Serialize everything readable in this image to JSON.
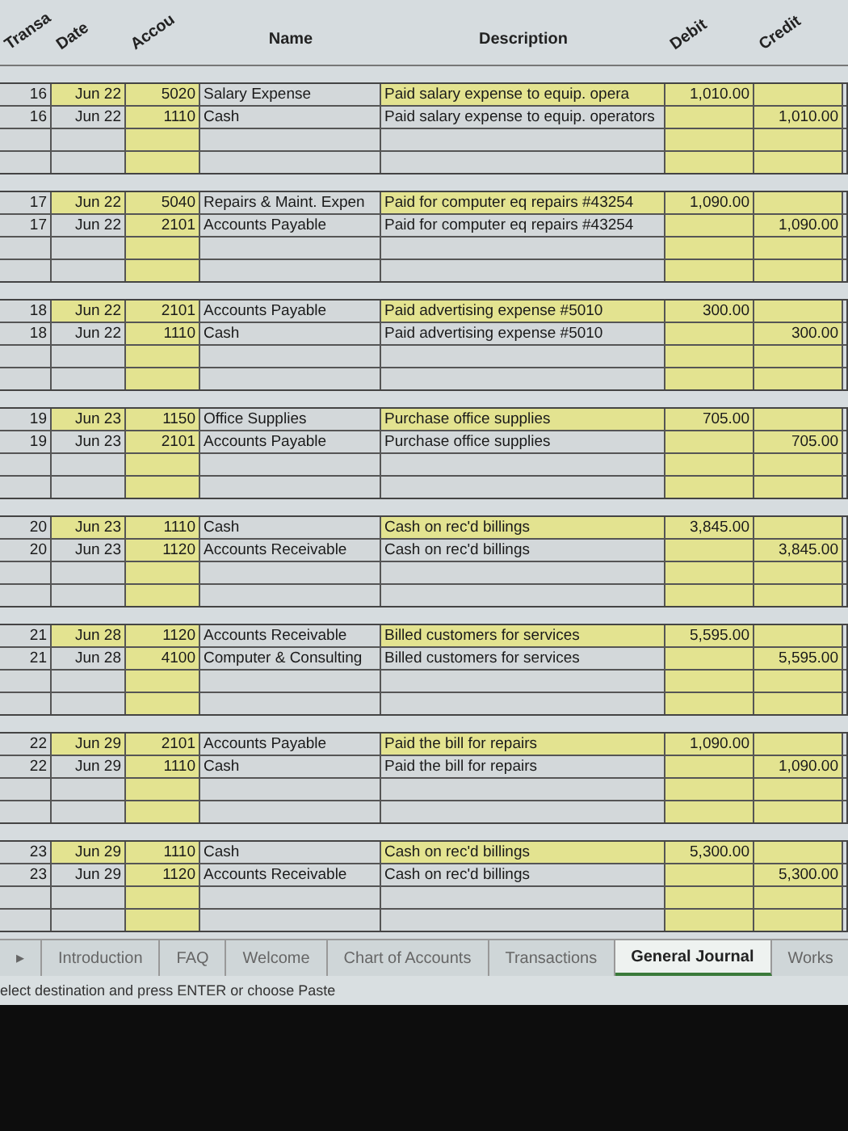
{
  "headers": [
    "Transa",
    "Date",
    "Accou",
    "Name",
    "Description",
    "Debit",
    "Credit"
  ],
  "entries": [
    {
      "lines": [
        {
          "trans": "16",
          "date": "Jun 22",
          "account": "5020",
          "name": "Salary Expense",
          "description": "Paid salary expense to equip. opera",
          "debit": "1,010.00"
        },
        {
          "trans": "16",
          "date": "Jun 22",
          "account": "1110",
          "name": "Cash",
          "description": "Paid salary expense to equip. operators",
          "credit": "1,010.00"
        }
      ]
    },
    {
      "lines": [
        {
          "trans": "17",
          "date": "Jun 22",
          "account": "5040",
          "name": "Repairs & Maint. Expen",
          "description": "Paid for computer eq repairs #43254",
          "debit": "1,090.00"
        },
        {
          "trans": "17",
          "date": "Jun 22",
          "account": "2101",
          "name": "Accounts Payable",
          "description": "Paid for computer eq repairs #43254",
          "credit": "1,090.00"
        }
      ]
    },
    {
      "lines": [
        {
          "trans": "18",
          "date": "Jun 22",
          "account": "2101",
          "name": "Accounts Payable",
          "description": "Paid advertising expense #5010",
          "debit": "300.00"
        },
        {
          "trans": "18",
          "date": "Jun 22",
          "account": "1110",
          "name": "Cash",
          "description": "Paid advertising expense #5010",
          "credit": "300.00"
        }
      ]
    },
    {
      "lines": [
        {
          "trans": "19",
          "date": "Jun 23",
          "account": "1150",
          "name": "Office Supplies",
          "description": "Purchase office supplies",
          "debit": "705.00"
        },
        {
          "trans": "19",
          "date": "Jun 23",
          "account": "2101",
          "name": "Accounts Payable",
          "description": "Purchase office supplies",
          "credit": "705.00"
        }
      ]
    },
    {
      "lines": [
        {
          "trans": "20",
          "date": "Jun 23",
          "account": "1110",
          "name": "Cash",
          "description": "Cash on rec'd billings",
          "debit": "3,845.00"
        },
        {
          "trans": "20",
          "date": "Jun 23",
          "account": "1120",
          "name": "Accounts Receivable",
          "description": "Cash on rec'd billings",
          "credit": "3,845.00"
        }
      ]
    },
    {
      "lines": [
        {
          "trans": "21",
          "date": "Jun 28",
          "account": "1120",
          "name": "Accounts Receivable",
          "description": "Billed customers for services",
          "debit": "5,595.00"
        },
        {
          "trans": "21",
          "date": "Jun 28",
          "account": "4100",
          "name": "Computer & Consulting",
          "description": "Billed customers for services",
          "credit": "5,595.00"
        }
      ]
    },
    {
      "lines": [
        {
          "trans": "22",
          "date": "Jun 29",
          "account": "2101",
          "name": "Accounts Payable",
          "description": "Paid the bill for repairs",
          "debit": "1,090.00"
        },
        {
          "trans": "22",
          "date": "Jun 29",
          "account": "1110",
          "name": "Cash",
          "description": "Paid the bill for repairs",
          "credit": "1,090.00"
        }
      ]
    },
    {
      "lines": [
        {
          "trans": "23",
          "date": "Jun 29",
          "account": "1110",
          "name": "Cash",
          "description": "Cash on rec'd billings",
          "debit": "5,300.00"
        },
        {
          "trans": "23",
          "date": "Jun 29",
          "account": "1120",
          "name": "Accounts Receivable",
          "description": "Cash on rec'd billings",
          "credit": "5,300.00"
        }
      ]
    }
  ],
  "sheet_tabs": [
    {
      "label": "▸",
      "selected": false
    },
    {
      "label": "Introduction",
      "selected": false
    },
    {
      "label": "FAQ",
      "selected": false
    },
    {
      "label": "Welcome",
      "selected": false
    },
    {
      "label": "Chart of Accounts",
      "selected": false
    },
    {
      "label": "Transactions",
      "selected": false
    },
    {
      "label": "General Journal",
      "selected": true
    },
    {
      "label": "Works",
      "selected": false
    }
  ],
  "status_bar": "elect destination and press ENTER or choose Paste"
}
